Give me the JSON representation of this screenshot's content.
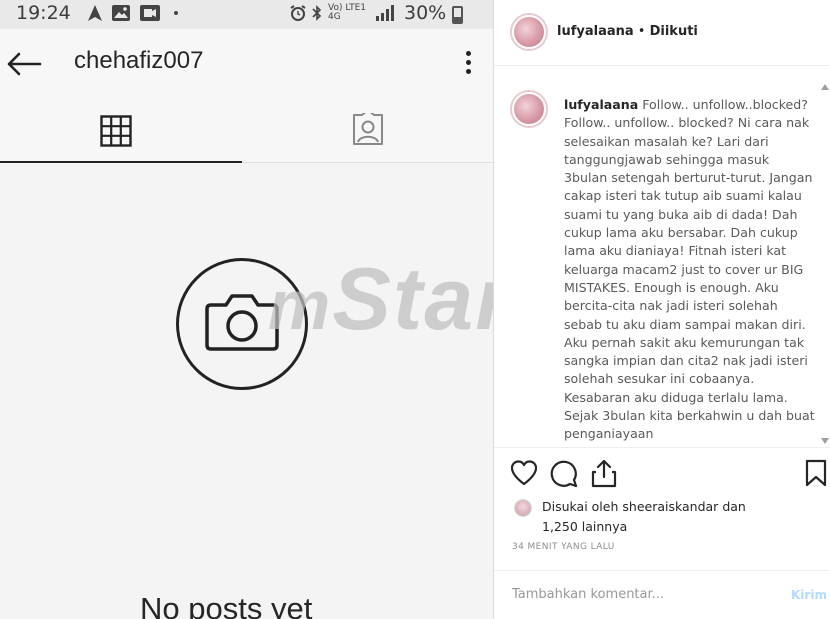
{
  "status_bar": {
    "time": "19:24",
    "network": "Vo) LTE1 4G",
    "battery": "30%"
  },
  "profile": {
    "username": "chehafiz007",
    "empty_state": "No posts yet"
  },
  "watermark": {
    "prefix": "m",
    "text": "Star"
  },
  "post": {
    "author": "lufyalaana",
    "separator": " • ",
    "follow_status": "Diikuti",
    "caption_user": "lufyalaana",
    "caption_text": "Follow.. unfollow..blocked? Follow.. unfollow.. blocked? Ni cara nak selesaikan masalah ke? Lari dari tanggungjawab sehingga masuk 3bulan setengah berturut-turut. Jangan cakap isteri tak tutup aib suami kalau suami tu yang buka aib di dada! Dah cukup lama aku bersabar. Dah cukup lama aku dianiaya! Fitnah isteri kat keluarga macam2 just to cover ur BIG MISTAKES. Enough is enough. Aku bercita-cita nak jadi isteri solehah sebab tu aku diam sampai makan diri. Aku pernah sakit aku kemurungan tak sangka impian dan cita2 nak jadi isteri solehah sesukar ini cobaanya. Kesabaran aku diduga terlalu lama. Sejak 3bulan kita berkahwin u dah buat penganiayaan",
    "likes_prefix": "Disukai oleh",
    "liker": "sheeraiskandar",
    "likes_suffix": "dan",
    "likes_count": "1,250 lainnya",
    "time_ago": "34 MENIT YANG LALU",
    "comment_placeholder": "Tambahkan komentar...",
    "post_button": "Kirim"
  }
}
